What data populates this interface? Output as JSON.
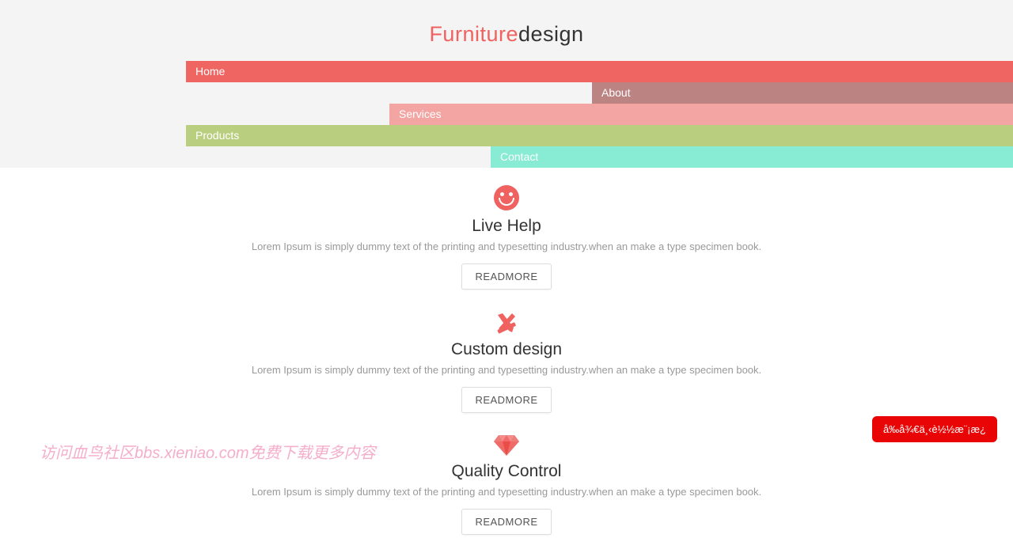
{
  "logo": {
    "first": "Furniture",
    "second": "design"
  },
  "nav": {
    "home": "Home",
    "about": "About",
    "services": "Services",
    "products": "Products",
    "contact": "Contact"
  },
  "features": [
    {
      "title": "Live Help",
      "desc": "Lorem Ipsum is simply dummy text of the printing and typesetting industry.when an make a type specimen book.",
      "button": "READMORE",
      "icon": "smiley"
    },
    {
      "title": "Custom design",
      "desc": "Lorem Ipsum is simply dummy text of the printing and typesetting industry.when an make a type specimen book.",
      "button": "READMORE",
      "icon": "pencil-ruler"
    },
    {
      "title": "Quality Control",
      "desc": "Lorem Ipsum is simply dummy text of the printing and typesetting industry.when an make a type specimen book.",
      "button": "READMORE",
      "icon": "diamond"
    }
  ],
  "watermark": "访问血鸟社区bbs.xieniao.com免费下载更多内容",
  "redButton": "å‰å¾€ä¸‹è½½æ¨¡æ¿",
  "colors": {
    "accent": "#f0625f"
  }
}
